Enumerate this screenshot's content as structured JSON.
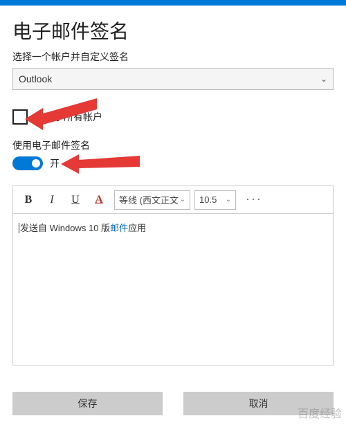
{
  "header": {
    "title": "电子邮件签名",
    "subtitle": "选择一个帐户并自定义签名"
  },
  "account_select": {
    "value": "Outlook"
  },
  "apply_all": {
    "label": "应用于所有帐户",
    "checked": false
  },
  "signature_toggle": {
    "section_label": "使用电子邮件签名",
    "state_label": "开",
    "on": true
  },
  "toolbar": {
    "bold": "B",
    "italic": "I",
    "underline": "U",
    "color": "A",
    "font_name": "等线 (西文正文",
    "font_size": "10.5",
    "more": "···"
  },
  "editor": {
    "prefix": "发送自 Windows 10 版",
    "link_text": "邮件",
    "suffix": "应用"
  },
  "buttons": {
    "save": "保存",
    "cancel": "取消"
  },
  "watermark": "百度经验"
}
